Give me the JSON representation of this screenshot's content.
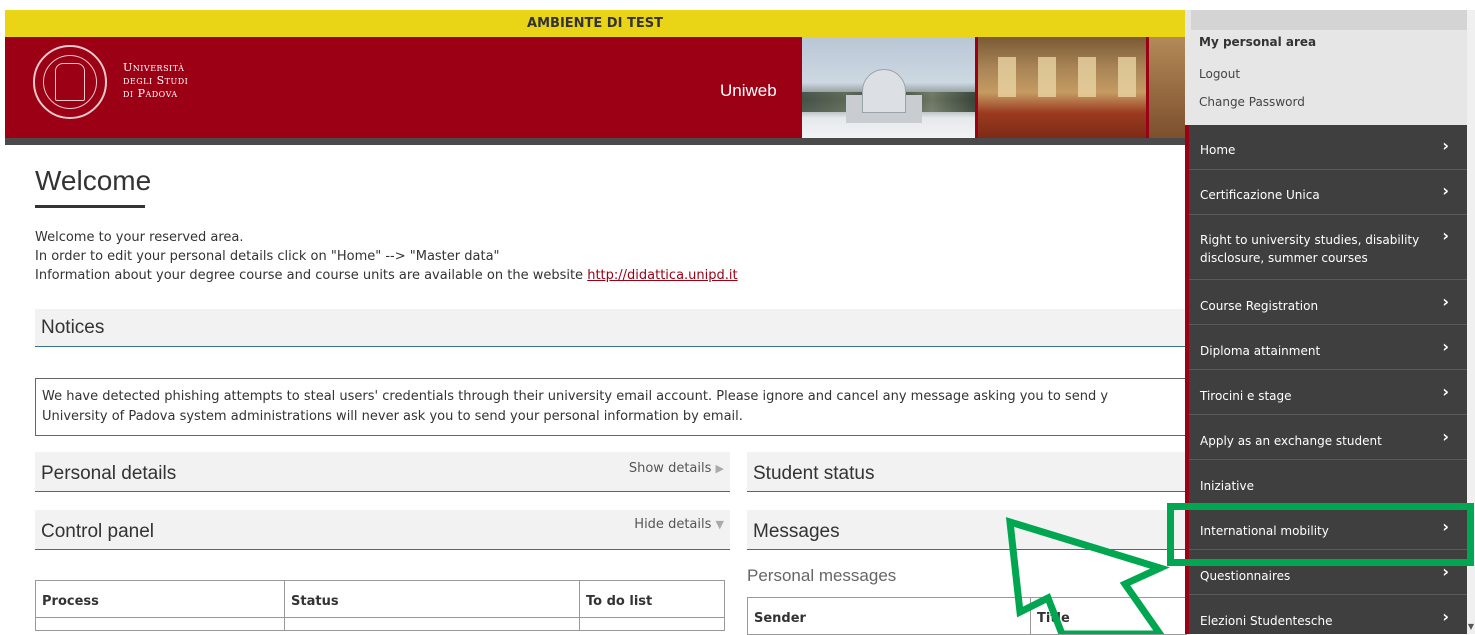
{
  "banner": {
    "test_label": "AMBIENTE DI TEST"
  },
  "header": {
    "university_line1": "Università",
    "university_line2": "degli Studi",
    "university_line3": "di Padova",
    "app_name": "Uniweb"
  },
  "welcome": {
    "title": "Welcome",
    "line1": "Welcome to your reserved area.",
    "line2": "In order to edit your personal details click on \"Home\" --> \"Master data\"",
    "line3_prefix": "Information about your degree course and course units are available on the website ",
    "link": "http://didattica.unipd.it"
  },
  "notices": {
    "title": "Notices",
    "line1": "We have detected phishing attempts to steal users' credentials through their university email account. Please ignore and cancel any message asking you to send y",
    "line2": "University of Padova system administrations will never ask you to send your personal information by email."
  },
  "personal_details": {
    "title": "Personal details",
    "toggle": "Show details"
  },
  "control_panel": {
    "title": "Control panel",
    "toggle": "Hide details",
    "columns": [
      "Process",
      "Status",
      "To do list"
    ]
  },
  "student_status": {
    "title": "Student status"
  },
  "messages": {
    "title": "Messages",
    "subtitle": "Personal messages",
    "columns": [
      "Sender",
      "Title"
    ]
  },
  "sidebar": {
    "personal_area": "My personal area",
    "logout": "Logout",
    "change_password": "Change Password",
    "menu": [
      {
        "label": "Home",
        "chevron": true
      },
      {
        "label": "Certificazione Unica",
        "chevron": true
      },
      {
        "label": "Right to university studies, disability disclosure, summer courses",
        "chevron": true
      },
      {
        "label": "Course Registration",
        "chevron": true
      },
      {
        "label": "Diploma attainment",
        "chevron": true
      },
      {
        "label": "Tirocini e stage",
        "chevron": true
      },
      {
        "label": "Apply as an exchange student",
        "chevron": true
      },
      {
        "label": "Iniziative",
        "chevron": false
      },
      {
        "label": "International mobility",
        "chevron": true
      },
      {
        "label": "Questionnaires",
        "chevron": true
      },
      {
        "label": "Elezioni Studentesche",
        "chevron": true
      }
    ],
    "highlighted_item": "International mobility"
  },
  "colors": {
    "brand_red": "#9b0014",
    "test_banner": "#e9d416",
    "sidebar_bg": "#3f3f3f",
    "highlight_green": "#00a650"
  },
  "icons": {
    "chevron": "chevron-right-icon",
    "show": "triangle-right-icon",
    "hide": "triangle-down-icon"
  }
}
